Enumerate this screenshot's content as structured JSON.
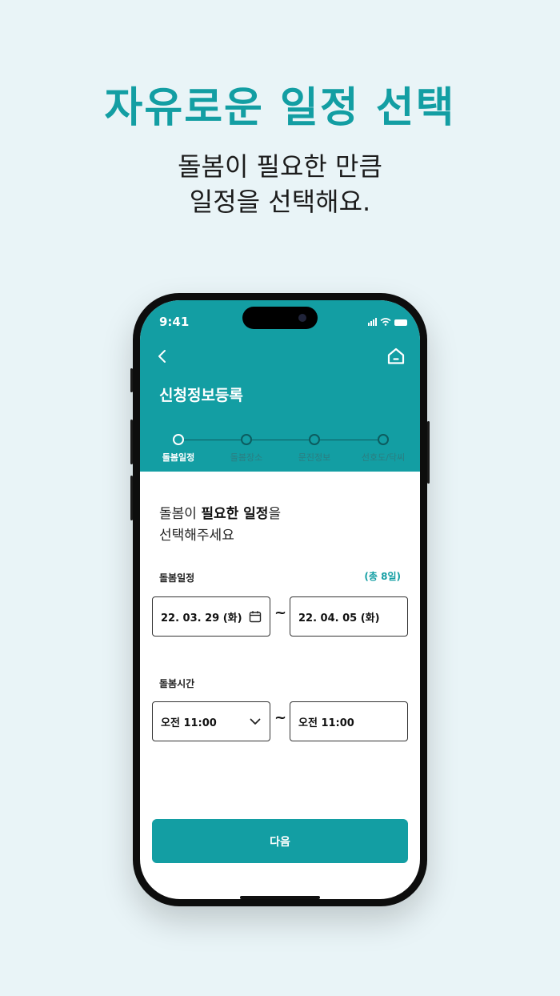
{
  "promo": {
    "headline": "자유로운 일정 선택",
    "sub_line1": "돌봄이 필요한 만큼",
    "sub_line2": "일정을 선택해요."
  },
  "status_bar": {
    "time": "9:41"
  },
  "header": {
    "title": "신청정보등록",
    "back_icon": "chevron-left-icon",
    "home_icon": "home-icon"
  },
  "stepper": {
    "steps": [
      {
        "label": "돌봄일정",
        "state": "active"
      },
      {
        "label": "돌봄장소",
        "state": "inactive"
      },
      {
        "label": "문진정보",
        "state": "inactive"
      },
      {
        "label": "선호도/닥씨",
        "state": "inactive"
      }
    ]
  },
  "guide": {
    "part1": "돌봄이 ",
    "bold": "필요한 일정",
    "part2": "을",
    "line2": "선택해주세요"
  },
  "schedule": {
    "label": "돌봄일정",
    "total": "(총 8일)",
    "start_date": "22. 03. 29 (화)",
    "end_date": "22. 04. 05 (화)",
    "separator": "~"
  },
  "time": {
    "label": "돌봄시간",
    "start_time": "오전 11:00",
    "end_time": "오전 11:00",
    "separator": "~"
  },
  "actions": {
    "next_label": "다음"
  },
  "colors": {
    "accent": "#139ea3",
    "background": "#e9f4f7"
  }
}
